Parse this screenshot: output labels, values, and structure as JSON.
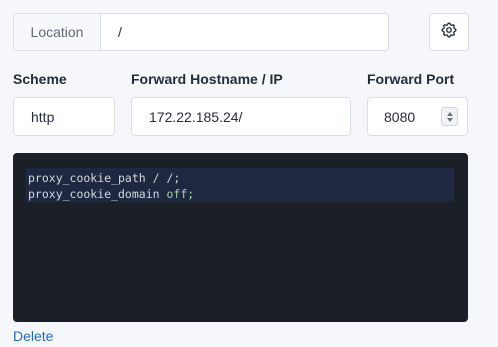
{
  "location": {
    "prefix_label": "Location",
    "value": "/"
  },
  "settings_icon": "gear-icon",
  "scheme": {
    "label": "Scheme",
    "value": "http"
  },
  "forward_host": {
    "label": "Forward Hostname / IP",
    "value": "172.22.185.24/"
  },
  "forward_port": {
    "label": "Forward Port",
    "value": "8080"
  },
  "editor": {
    "lines": [
      {
        "key": "proxy_cookie_path",
        "args": " / /;"
      },
      {
        "key": "proxy_cookie_domain",
        "args": " off;"
      }
    ]
  },
  "delete_label": "Delete",
  "colors": {
    "accent": "#206bc4",
    "editor_bg": "#1b1f28",
    "page_bg": "#f5f7fb"
  }
}
